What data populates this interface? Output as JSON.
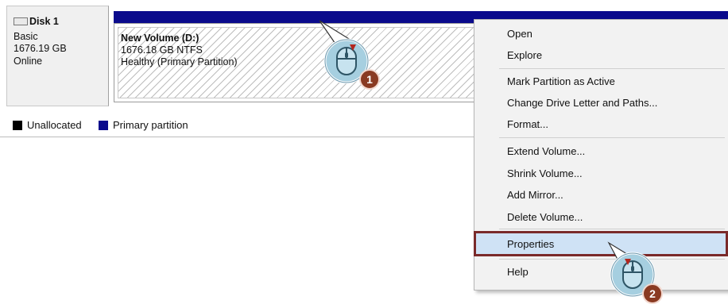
{
  "disk": {
    "name": "Disk 1",
    "type": "Basic",
    "size": "1676.19 GB",
    "status": "Online"
  },
  "volume": {
    "name": "New Volume  (D:)",
    "size_fs": "1676.18 GB NTFS",
    "health": "Healthy (Primary Partition)"
  },
  "legend": {
    "items": [
      {
        "label": "Unallocated",
        "color": "#000000"
      },
      {
        "label": "Primary partition",
        "color": "#0a0a8c"
      }
    ]
  },
  "context_menu": {
    "items": [
      "Open",
      "Explore",
      "Mark Partition as Active",
      "Change Drive Letter and Paths...",
      "Format...",
      "Extend Volume...",
      "Shrink Volume...",
      "Add Mirror...",
      "Delete Volume...",
      "Properties",
      "Help"
    ],
    "highlighted": "Properties"
  },
  "callouts": {
    "step1": "1",
    "step2": "2",
    "highlight_color": "#7a2a2a",
    "badge_color": "#8a3a22"
  }
}
